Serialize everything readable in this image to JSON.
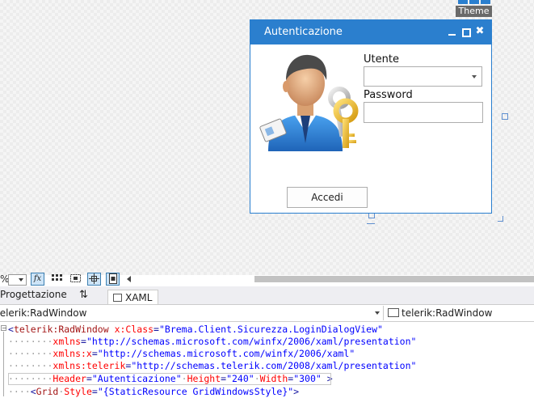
{
  "theme_badge": {
    "label": "Theme"
  },
  "dialog": {
    "title": "Autenticazione",
    "close_glyph": "✖",
    "utente_label": "Utente",
    "password_label": "Password",
    "utente_value": "",
    "password_value": "",
    "accedi_label": "Accedi",
    "icon": "user-key-icon"
  },
  "toolbar": {
    "zoom_label": "%",
    "fx_label": "fx"
  },
  "tabs": {
    "design_label": "Progettazione",
    "swap_glyph": "⇅",
    "xaml_label": "XAML"
  },
  "nav": {
    "type_value": "telerik:RadWindow",
    "member_value": "telerik:RadWindow"
  },
  "code": {
    "lines": [
      "<telerik:RadWindow x:Class=\"Brema.Client.Sicurezza.LoginDialogView\"",
      "xmlns=\"http://schemas.microsoft.com/winfx/2006/xaml/presentation\"",
      "xmlns:x=\"http://schemas.microsoft.com/winfx/2006/xaml\"",
      "xmlns:telerik=\"http://schemas.telerik.com/2008/xaml/presentation\"",
      "Header=\"Autenticazione\" Height=\"240\" Width=\"300\" >",
      "<Grid Style=\"{StaticResource GridWindowsStyle}\">"
    ],
    "l1": {
      "open": "<",
      "elem": "telerik:RadWindow",
      "attr": "x:Class",
      "eq": "=",
      "val": "\"Brema.Client.Sicurezza.LoginDialogView\""
    },
    "l2": {
      "attr": "xmlns",
      "eq": "=",
      "val": "\"http://schemas.microsoft.com/winfx/2006/xaml/presentation\""
    },
    "l3": {
      "attr": "xmlns:x",
      "eq": "=",
      "val": "\"http://schemas.microsoft.com/winfx/2006/xaml\""
    },
    "l4": {
      "attr": "xmlns:telerik",
      "eq": "=",
      "val": "\"http://schemas.telerik.com/2008/xaml/presentation\""
    },
    "l5": {
      "a1": "Header",
      "v1": "\"Autenticazione\"",
      "a2": "Height",
      "v2": "\"240\"",
      "a3": "Width",
      "v3": "\"300\"",
      "close": " >"
    },
    "l6": {
      "open": "<",
      "elem": "Grid",
      "attr": "Style",
      "eq": "=",
      "val": "\"{StaticResource GridWindowsStyle}\"",
      "close": ">"
    }
  },
  "colors": {
    "accent": "#2b7fce",
    "xml_element": "#a31515",
    "xml_attribute": "#ff0000",
    "xml_value": "#0000ff"
  }
}
